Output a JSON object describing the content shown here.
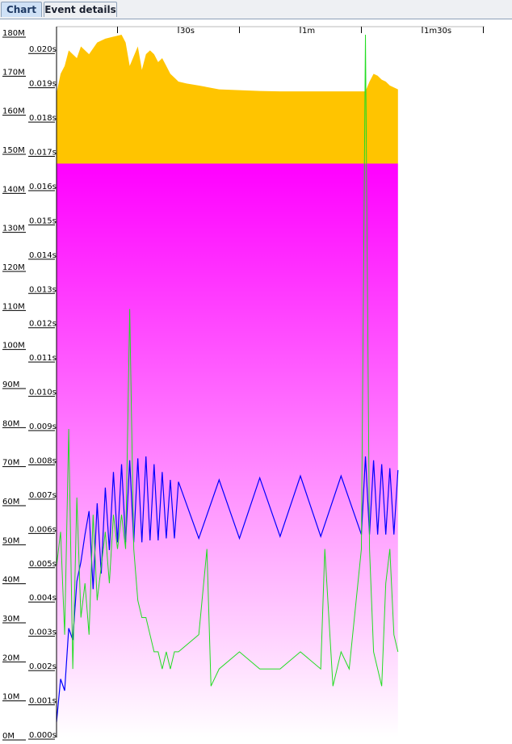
{
  "tabs": [
    {
      "label": "Chart",
      "active": true
    },
    {
      "label": "Event details",
      "active": false
    }
  ],
  "chart_data": {
    "type": "area",
    "x_axis": {
      "min": 0,
      "max": 105,
      "unit": "s",
      "ticks": [
        {
          "value": 0,
          "label": ""
        },
        {
          "value": 15,
          "label": ""
        },
        {
          "value": 30,
          "label": "30s"
        },
        {
          "value": 45,
          "label": ""
        },
        {
          "value": 60,
          "label": "1m"
        },
        {
          "value": 75,
          "label": ""
        },
        {
          "value": 90,
          "label": "1m30s"
        },
        {
          "value": 105,
          "label": ""
        }
      ]
    },
    "y_axis_memory": {
      "min": 0,
      "max": 180000000,
      "ticks": [
        "0M",
        "10M",
        "20M",
        "30M",
        "40M",
        "50M",
        "60M",
        "70M",
        "80M",
        "90M",
        "100M",
        "110M",
        "120M",
        "130M",
        "140M",
        "150M",
        "160M",
        "170M",
        "180M"
      ]
    },
    "y_axis_time": {
      "min": 0,
      "max": 0.0205,
      "ticks": [
        "0.000s",
        "0.001s",
        "0.002s",
        "0.003s",
        "0.004s",
        "0.005s",
        "0.006s",
        "0.007s",
        "0.008s",
        "0.009s",
        "0.010s",
        "0.011s",
        "0.012s",
        "0.013s",
        "0.014s",
        "0.015s",
        "0.016s",
        "0.017s",
        "0.018s",
        "0.019s",
        "0.020s"
      ]
    },
    "series": [
      {
        "kind": "area",
        "color": "#ffc400",
        "x": [
          0,
          1,
          2,
          3,
          5,
          6,
          8,
          10,
          12,
          14,
          16,
          17,
          18,
          20,
          21,
          22,
          23,
          24,
          25,
          26,
          27,
          28,
          29,
          30,
          32,
          35,
          40,
          45,
          50,
          55,
          60,
          65,
          70,
          75,
          76,
          77,
          78,
          79,
          80,
          81,
          82,
          83,
          84
        ],
        "y": [
          165000000,
          170000000,
          172000000,
          176000000,
          174000000,
          177000000,
          175000000,
          178000000,
          179000000,
          179500000,
          180000000,
          178000000,
          172000000,
          177000000,
          171000000,
          175000000,
          176000000,
          175000000,
          173000000,
          174000000,
          172000000,
          170000000,
          169000000,
          168000000,
          167500000,
          167000000,
          166000000,
          165800000,
          165600000,
          165500000,
          165500000,
          165500000,
          165500000,
          165500000,
          165500000,
          168000000,
          170000000,
          169500000,
          168500000,
          168000000,
          167000000,
          166500000,
          166000000
        ]
      },
      {
        "kind": "area",
        "gradient": [
          "#ff00ff",
          "#ffffff"
        ],
        "x": [
          0,
          84
        ],
        "y": [
          147000000,
          147000000
        ]
      },
      {
        "kind": "line",
        "color": "#0000ff",
        "x": [
          0,
          1,
          2,
          3,
          4,
          5,
          6,
          7,
          8,
          9,
          10,
          11,
          12,
          13,
          14,
          15,
          16,
          17,
          18,
          19,
          20,
          21,
          22,
          23,
          24,
          25,
          26,
          27,
          28,
          29,
          30,
          35,
          40,
          45,
          50,
          55,
          60,
          65,
          70,
          75,
          76,
          77,
          78,
          79,
          80,
          81,
          82,
          83,
          84
        ],
        "y": [
          4000000,
          15000000,
          12000000,
          28000000,
          25000000,
          40000000,
          45000000,
          52000000,
          58000000,
          38000000,
          60000000,
          42000000,
          64000000,
          48000000,
          68000000,
          50000000,
          70000000,
          50000000,
          71000000,
          50000000,
          71500000,
          50000000,
          72000000,
          50500000,
          70000000,
          50500000,
          68000000,
          51000000,
          66000000,
          51000000,
          65500000,
          51000000,
          66000000,
          51000000,
          66500000,
          51500000,
          67000000,
          51500000,
          67000000,
          52000000,
          72000000,
          52000000,
          71000000,
          52000000,
          70000000,
          52000000,
          69000000,
          52000000,
          68500000
        ]
      },
      {
        "kind": "line",
        "color": "#22dd22",
        "x": [
          0,
          1,
          2,
          3,
          4,
          5,
          6,
          7,
          8,
          9,
          10,
          11,
          12,
          13,
          14,
          15,
          16,
          17,
          18,
          19,
          20,
          21,
          22,
          23,
          24,
          25,
          26,
          27,
          28,
          29,
          30,
          35,
          37,
          38,
          40,
          45,
          50,
          55,
          60,
          65,
          66,
          68,
          70,
          72,
          75,
          76,
          77,
          78,
          79,
          80,
          81,
          82,
          83,
          84
        ],
        "y": [
          0.005,
          0.006,
          0.003,
          0.009,
          0.002,
          0.007,
          0.0035,
          0.0045,
          0.003,
          0.0065,
          0.004,
          0.005,
          0.006,
          0.0045,
          0.0065,
          0.0055,
          0.0065,
          0.0055,
          0.0125,
          0.0055,
          0.004,
          0.0035,
          0.0035,
          0.003,
          0.0025,
          0.0025,
          0.002,
          0.0025,
          0.002,
          0.0025,
          0.0025,
          0.003,
          0.0055,
          0.0015,
          0.002,
          0.0025,
          0.002,
          0.002,
          0.0025,
          0.002,
          0.0055,
          0.0015,
          0.0025,
          0.002,
          0.0055,
          0.0205,
          0.0055,
          0.0025,
          0.002,
          0.0015,
          0.0045,
          0.0055,
          0.003,
          0.0025
        ]
      }
    ]
  }
}
